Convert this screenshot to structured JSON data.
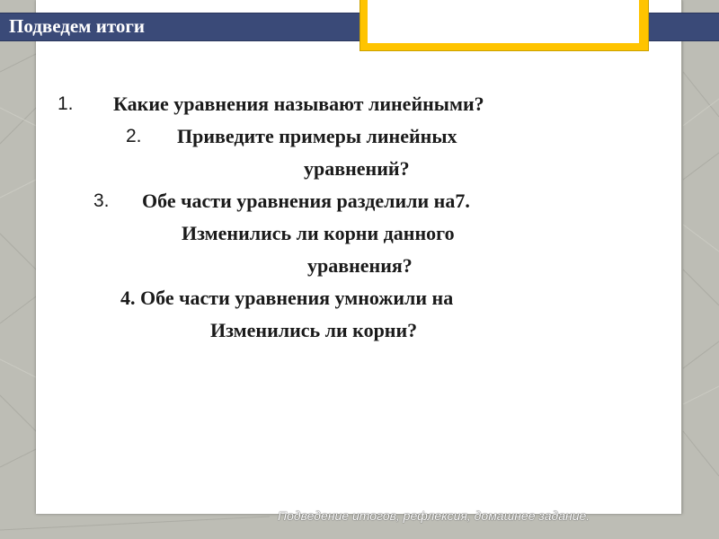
{
  "slide": {
    "title": "Подведем итоги",
    "footer": "Подведение итогов, рефлексия,  домашнее задание.",
    "items": [
      {
        "number": "1.",
        "text": "Какие уравнения называют линейными?"
      },
      {
        "number": "2.",
        "text": "Приведите примеры линейных",
        "text_cont": "уравнений?"
      },
      {
        "number": "3.",
        "text": "Обе части уравнения разделили на7.",
        "text_cont": "Изменились ли корни данного",
        "text_cont2": "уравнения?"
      },
      {
        "text": "4. Обе части уравнения умножили на",
        "text_cont": "Изменились ли корни?"
      }
    ]
  },
  "colors": {
    "title_bar": "#3a4a78",
    "accent": "#ffc400",
    "background": "#bdbdb5"
  }
}
